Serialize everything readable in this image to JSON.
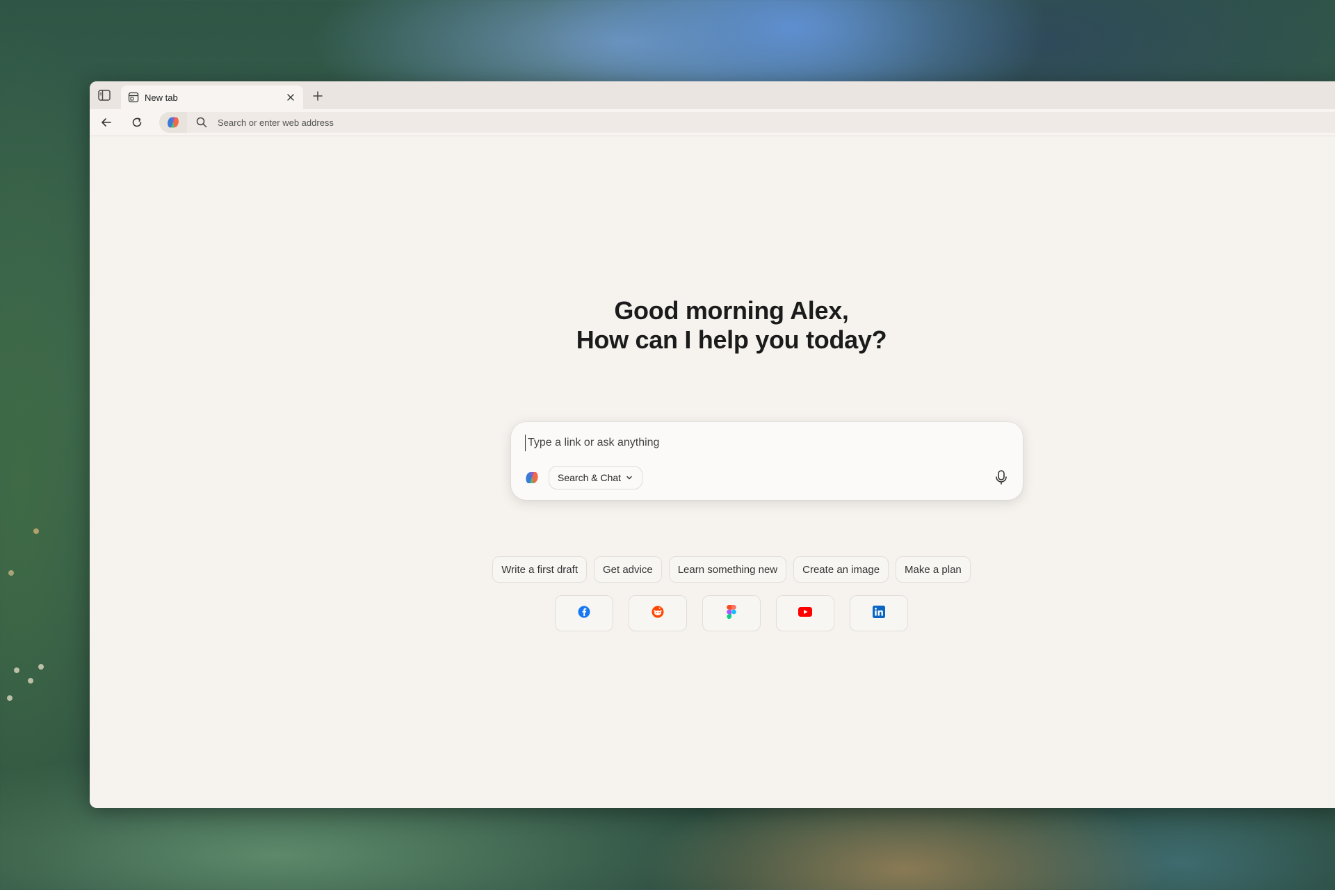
{
  "tab": {
    "title": "New tab",
    "close_icon": "close-icon",
    "new_tab_icon": "plus-icon"
  },
  "toolbar": {
    "address_placeholder": "Search or enter web address"
  },
  "main": {
    "greeting_line1": "Good morning Alex,",
    "greeting_line2": "How can I help you today?",
    "composer_placeholder": "Type a link or ask anything",
    "mode_label": "Search & Chat"
  },
  "suggestions": [
    {
      "label": "Write a first draft"
    },
    {
      "label": "Get advice"
    },
    {
      "label": "Learn something new"
    },
    {
      "label": "Create an image"
    },
    {
      "label": "Make a plan"
    }
  ],
  "shortcuts": [
    {
      "icon": "facebook-icon",
      "color": "#1877F2"
    },
    {
      "icon": "reddit-icon",
      "color": "#FF4500"
    },
    {
      "icon": "figma-icon",
      "color": "#A259FF"
    },
    {
      "icon": "youtube-icon",
      "color": "#FF0000"
    },
    {
      "icon": "linkedin-icon",
      "color": "#0A66C2"
    }
  ]
}
